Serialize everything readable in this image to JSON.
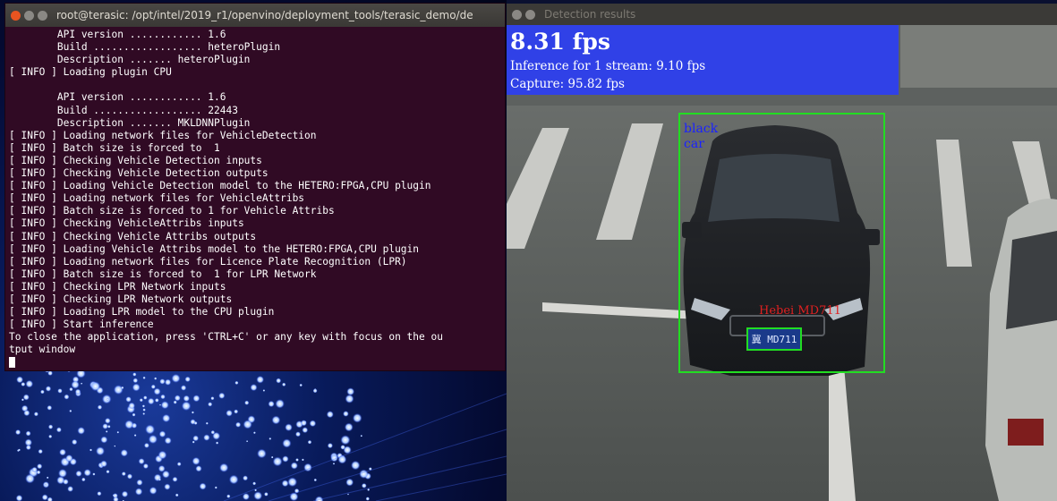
{
  "terminal": {
    "title": "root@terasic: /opt/intel/2019_r1/openvino/deployment_tools/terasic_demo/de",
    "lines": [
      "        API version ............ 1.6",
      "        Build .................. heteroPlugin",
      "        Description ....... heteroPlugin",
      "[ INFO ] Loading plugin CPU",
      "",
      "        API version ............ 1.6",
      "        Build .................. 22443",
      "        Description ....... MKLDNNPlugin",
      "[ INFO ] Loading network files for VehicleDetection",
      "[ INFO ] Batch size is forced to  1",
      "[ INFO ] Checking Vehicle Detection inputs",
      "[ INFO ] Checking Vehicle Detection outputs",
      "[ INFO ] Loading Vehicle Detection model to the HETERO:FPGA,CPU plugin",
      "[ INFO ] Loading network files for VehicleAttribs",
      "[ INFO ] Batch size is forced to 1 for Vehicle Attribs",
      "[ INFO ] Checking VehicleAttribs inputs",
      "[ INFO ] Checking Vehicle Attribs outputs",
      "[ INFO ] Loading Vehicle Attribs model to the HETERO:FPGA,CPU plugin",
      "[ INFO ] Loading network files for Licence Plate Recognition (LPR)",
      "[ INFO ] Batch size is forced to  1 for LPR Network",
      "[ INFO ] Checking LPR Network inputs",
      "[ INFO ] Checking LPR Network outputs",
      "[ INFO ] Loading LPR model to the CPU plugin",
      "[ INFO ] Start inference",
      "To close the application, press 'CTRL+C' or any key with focus on the ou",
      "tput window"
    ]
  },
  "detection": {
    "title": "Detection results",
    "fps": "8.31 fps",
    "inference": "Inference for 1 stream: 9.10 fps",
    "capture": "Capture: 95.82 fps",
    "car_label": "black\ncar",
    "plate_text": "Hebei MD711",
    "plate_chars": "冀 MD711"
  },
  "colors": {
    "terminal_bg": "#300a24",
    "overlay": "#2838ff",
    "bbox": "#22dd22"
  }
}
